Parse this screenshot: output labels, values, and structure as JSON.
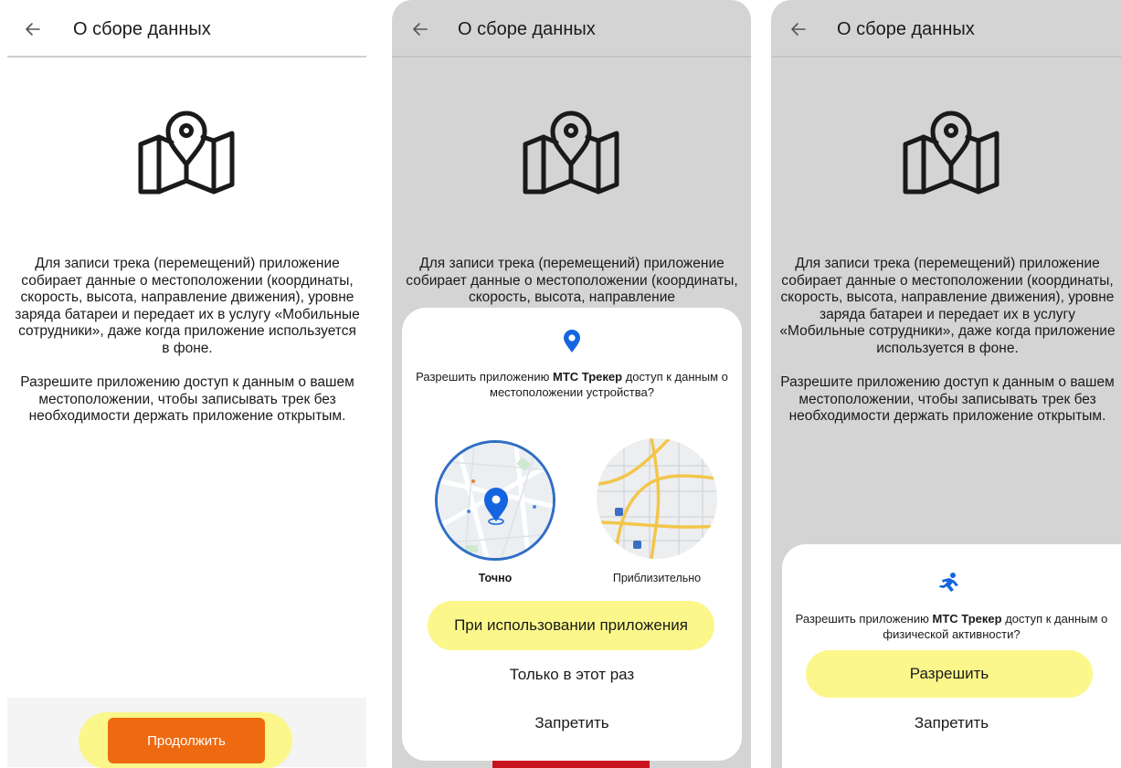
{
  "screen1": {
    "title": "О сборе данных",
    "paragraph1": "Для записи трека (перемещений) приложение собирает данные о местоположении (координаты, скорость, высота, направление движения), уровне заряда батареи и передает их в услугу «Мобильные сотрудники», даже когда приложение используется в фоне.",
    "paragraph2": "Разрешите приложению доступ к данным о вашем местоположении, чтобы записывать трек без необходимости держать приложение открытым.",
    "continue_label": "Продолжить",
    "accent_color": "#ee6a10",
    "highlight_color": "#fbf78a"
  },
  "screen2": {
    "title": "О сборе данных",
    "paragraph_visible": "Для записи трека (перемещений) приложение собирает данные о местоположении (координаты, скорость, высота, направление",
    "dialog": {
      "icon": "location-pin-icon",
      "prompt_before": "Разрешить приложению ",
      "app_name": "МТС Трекер",
      "prompt_after": " доступ к данным о местоположении устройства?",
      "option_precise": "Точно",
      "option_approximate": "Приблизительно",
      "button_while_using": "При использовании приложения",
      "button_only_this_time": "Только в этот раз",
      "button_deny": "Запретить"
    }
  },
  "screen3": {
    "title": "О сборе данных",
    "paragraph1": "Для записи трека (перемещений) приложение собирает данные о местоположении (координаты, скорость, высота, направление движения), уровне заряда батареи и передает их в услугу «Мобильные сотрудники», даже когда приложение используется в фоне.",
    "paragraph2": "Разрешите приложению доступ к данным о вашем местоположении, чтобы записывать трек без необходимости держать приложение открытым.",
    "dialog": {
      "icon": "running-person-icon",
      "prompt_before": "Разрешить приложению ",
      "app_name": "МТС Трекер",
      "prompt_after": " доступ к данным о физической активности?",
      "button_allow": "Разрешить",
      "button_deny": "Запретить"
    }
  }
}
